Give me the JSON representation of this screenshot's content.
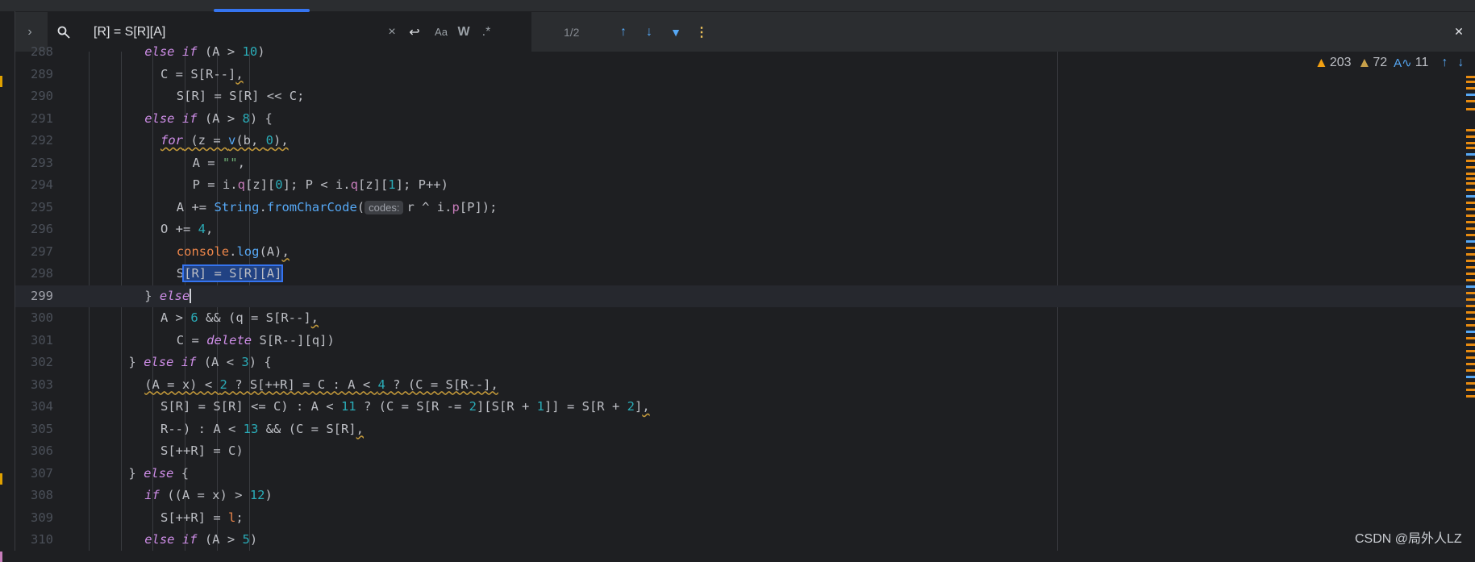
{
  "find_bar": {
    "query": "[R] = S[R][A]",
    "match_count": "1/2",
    "icons": [
      "expand-arrow-icon",
      "search-history-icon",
      "clear-icon",
      "newline-icon",
      "match-case-icon",
      "whole-words-icon",
      "regex-icon",
      "prev-occurrence-icon",
      "next-occurrence-icon",
      "filter-icon",
      "more-options-icon",
      "close-icon"
    ],
    "labels": {
      "clear": "×",
      "newline": "↩",
      "match_case": "Aa",
      "words": "W",
      "regex": ".*",
      "prev": "↑",
      "next": "↓",
      "filter": "▼",
      "more": "⋮",
      "close": "✕",
      "expand": "›",
      "search": "⚲"
    }
  },
  "inspections": {
    "warnings": "203",
    "weak_warnings": "72",
    "typos": "11"
  },
  "watermark": "CSDN @局外人LZ",
  "colors": {
    "accent": "#3574f0",
    "warning": "#f2a012",
    "background": "#1e1f22"
  },
  "lines": [
    {
      "n": "288",
      "i": 8,
      "segs": [
        [
          "else if",
          "kw"
        ],
        [
          " (A > ",
          ""
        ],
        [
          "10",
          "num"
        ],
        [
          ")",
          ""
        ]
      ]
    },
    {
      "n": "289",
      "i": 10,
      "segs": [
        [
          "C = S[R--]",
          ""
        ],
        [
          ",",
          "wave"
        ]
      ]
    },
    {
      "n": "290",
      "i": 12,
      "segs": [
        [
          "S[R] = S[R] << C;",
          ""
        ]
      ]
    },
    {
      "n": "291",
      "i": 8,
      "segs": [
        [
          "else if",
          "kw"
        ],
        [
          " (A > ",
          ""
        ],
        [
          "8",
          "num"
        ],
        [
          ") {",
          ""
        ]
      ]
    },
    {
      "n": "292",
      "i": 10,
      "segs": [
        [
          "for",
          "kw wave"
        ],
        [
          " (z = ",
          "wave"
        ],
        [
          "v",
          "fn wave"
        ],
        [
          "(b, ",
          "wave"
        ],
        [
          "0",
          "num wave"
        ],
        [
          "),",
          "wave"
        ]
      ]
    },
    {
      "n": "293",
      "i": 14,
      "segs": [
        [
          "A = ",
          ""
        ],
        [
          "\"\"",
          "str"
        ],
        [
          ",",
          ""
        ]
      ]
    },
    {
      "n": "294",
      "i": 14,
      "segs": [
        [
          "P = i.",
          ""
        ],
        [
          "q",
          "prop"
        ],
        [
          "[z][",
          ""
        ],
        [
          "0",
          "num"
        ],
        [
          "]; P < i.",
          ""
        ],
        [
          "q",
          "prop"
        ],
        [
          "[z][",
          ""
        ],
        [
          "1",
          "num"
        ],
        [
          "]; P++)",
          ""
        ]
      ]
    },
    {
      "n": "295",
      "i": 12,
      "segs": [
        [
          "A += ",
          ""
        ],
        [
          "String",
          "fn"
        ],
        [
          ".",
          ""
        ],
        [
          "fromCharCode",
          "fn"
        ],
        [
          "(",
          ""
        ],
        [
          "codes:",
          "hint"
        ],
        [
          "r ^ i.",
          ""
        ],
        [
          "p",
          "prop"
        ],
        [
          "[P]);",
          ""
        ]
      ]
    },
    {
      "n": "296",
      "i": 10,
      "segs": [
        [
          "O += ",
          ""
        ],
        [
          "4",
          "num"
        ],
        [
          ",",
          ""
        ]
      ]
    },
    {
      "n": "297",
      "i": 12,
      "segs": [
        [
          "console",
          "log"
        ],
        [
          ".",
          ""
        ],
        [
          "log",
          "fn"
        ],
        [
          "(A)",
          ""
        ],
        [
          ",",
          "wave"
        ]
      ]
    },
    {
      "n": "298",
      "i": 12,
      "segs": [
        [
          "S",
          ""
        ],
        [
          "[R] = S[R][A]",
          "sel"
        ]
      ]
    },
    {
      "n": "299",
      "i": 8,
      "cur": true,
      "segs": [
        [
          "} ",
          ""
        ],
        [
          "else",
          "kw"
        ],
        [
          "",
          "caret"
        ]
      ]
    },
    {
      "n": "300",
      "i": 10,
      "segs": [
        [
          "A > ",
          ""
        ],
        [
          "6",
          "num"
        ],
        [
          " && (q = S[R--]",
          ""
        ],
        [
          ",",
          "wave"
        ]
      ]
    },
    {
      "n": "301",
      "i": 12,
      "segs": [
        [
          "C = ",
          ""
        ],
        [
          "delete",
          "kw"
        ],
        [
          " S[R--][q])",
          ""
        ]
      ]
    },
    {
      "n": "302",
      "i": 6,
      "segs": [
        [
          "} ",
          ""
        ],
        [
          "else if",
          "kw"
        ],
        [
          " (A < ",
          ""
        ],
        [
          "3",
          "num"
        ],
        [
          ") {",
          ""
        ]
      ]
    },
    {
      "n": "303",
      "i": 8,
      "segs": [
        [
          "(A = x) < ",
          "wave"
        ],
        [
          "2",
          "num wave"
        ],
        [
          " ? S[++R] = C : A < ",
          "wave"
        ],
        [
          "4",
          "num wave"
        ],
        [
          " ? (C = S[R--],",
          "wave"
        ]
      ]
    },
    {
      "n": "304",
      "i": 10,
      "segs": [
        [
          "S[R] = S[R] <= C) : A < ",
          ""
        ],
        [
          "11",
          "num"
        ],
        [
          " ? (C = S[R -= ",
          ""
        ],
        [
          "2",
          "num"
        ],
        [
          "][S[R + ",
          ""
        ],
        [
          "1",
          "num"
        ],
        [
          "]] = S[R + ",
          ""
        ],
        [
          "2",
          "num"
        ],
        [
          "]",
          ""
        ],
        [
          ",",
          "wave"
        ]
      ]
    },
    {
      "n": "305",
      "i": 10,
      "segs": [
        [
          "R--) : A < ",
          ""
        ],
        [
          "13",
          "num"
        ],
        [
          " && (C = S[R]",
          ""
        ],
        [
          ",",
          "wave"
        ]
      ]
    },
    {
      "n": "306",
      "i": 10,
      "segs": [
        [
          "S[++R] = C)",
          ""
        ]
      ]
    },
    {
      "n": "307",
      "i": 6,
      "segs": [
        [
          "} ",
          ""
        ],
        [
          "else",
          "kw"
        ],
        [
          " {",
          ""
        ]
      ]
    },
    {
      "n": "308",
      "i": 8,
      "segs": [
        [
          "if",
          "kw"
        ],
        [
          " ((A = x) > ",
          ""
        ],
        [
          "12",
          "num"
        ],
        [
          ")",
          ""
        ]
      ]
    },
    {
      "n": "309",
      "i": 10,
      "segs": [
        [
          "S[++R] = ",
          ""
        ],
        [
          "l",
          "log"
        ],
        [
          ";",
          ""
        ]
      ]
    },
    {
      "n": "310",
      "i": 8,
      "segs": [
        [
          "else if",
          "kw"
        ],
        [
          " (A > ",
          ""
        ],
        [
          "5",
          "num"
        ],
        [
          ")",
          ""
        ]
      ]
    }
  ]
}
